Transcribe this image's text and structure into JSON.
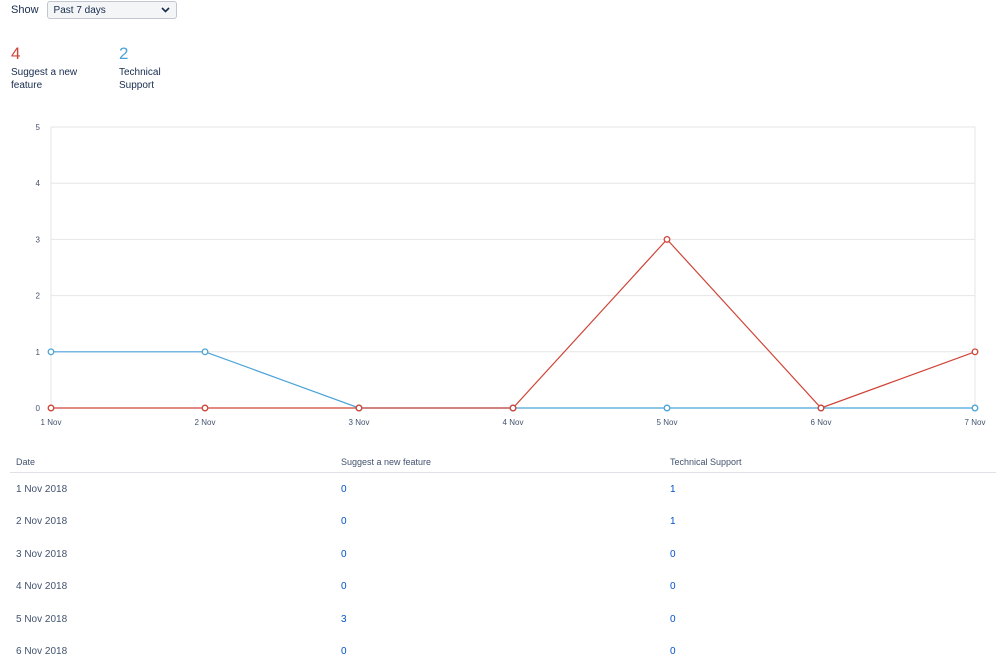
{
  "filter": {
    "label": "Show",
    "selected": "Past 7 days"
  },
  "summary": [
    {
      "count": "4",
      "label": "Suggest a new feature",
      "color": "#d04437"
    },
    {
      "count": "2",
      "label": "Technical Support",
      "color": "#4ba3d9"
    }
  ],
  "chart_data": {
    "type": "line",
    "categories": [
      "1 Nov",
      "2 Nov",
      "3 Nov",
      "4 Nov",
      "5 Nov",
      "6 Nov",
      "7 Nov"
    ],
    "series": [
      {
        "name": "Suggest a new feature",
        "color": "#d04437",
        "values": [
          0,
          0,
          0,
          0,
          3,
          0,
          1
        ]
      },
      {
        "name": "Technical Support",
        "color": "#4ba3d9",
        "values": [
          1,
          1,
          0,
          0,
          0,
          0,
          0
        ]
      }
    ],
    "yticks": [
      "0",
      "1",
      "2",
      "3",
      "4",
      "5"
    ],
    "ylim": [
      0,
      5
    ],
    "grid": true
  },
  "table": {
    "headers": [
      "Date",
      "Suggest a new feature",
      "Technical Support"
    ],
    "rows": [
      [
        "1 Nov 2018",
        "0",
        "1"
      ],
      [
        "2 Nov 2018",
        "0",
        "1"
      ],
      [
        "3 Nov 2018",
        "0",
        "0"
      ],
      [
        "4 Nov 2018",
        "0",
        "0"
      ],
      [
        "5 Nov 2018",
        "3",
        "0"
      ],
      [
        "6 Nov 2018",
        "0",
        "0"
      ]
    ]
  }
}
